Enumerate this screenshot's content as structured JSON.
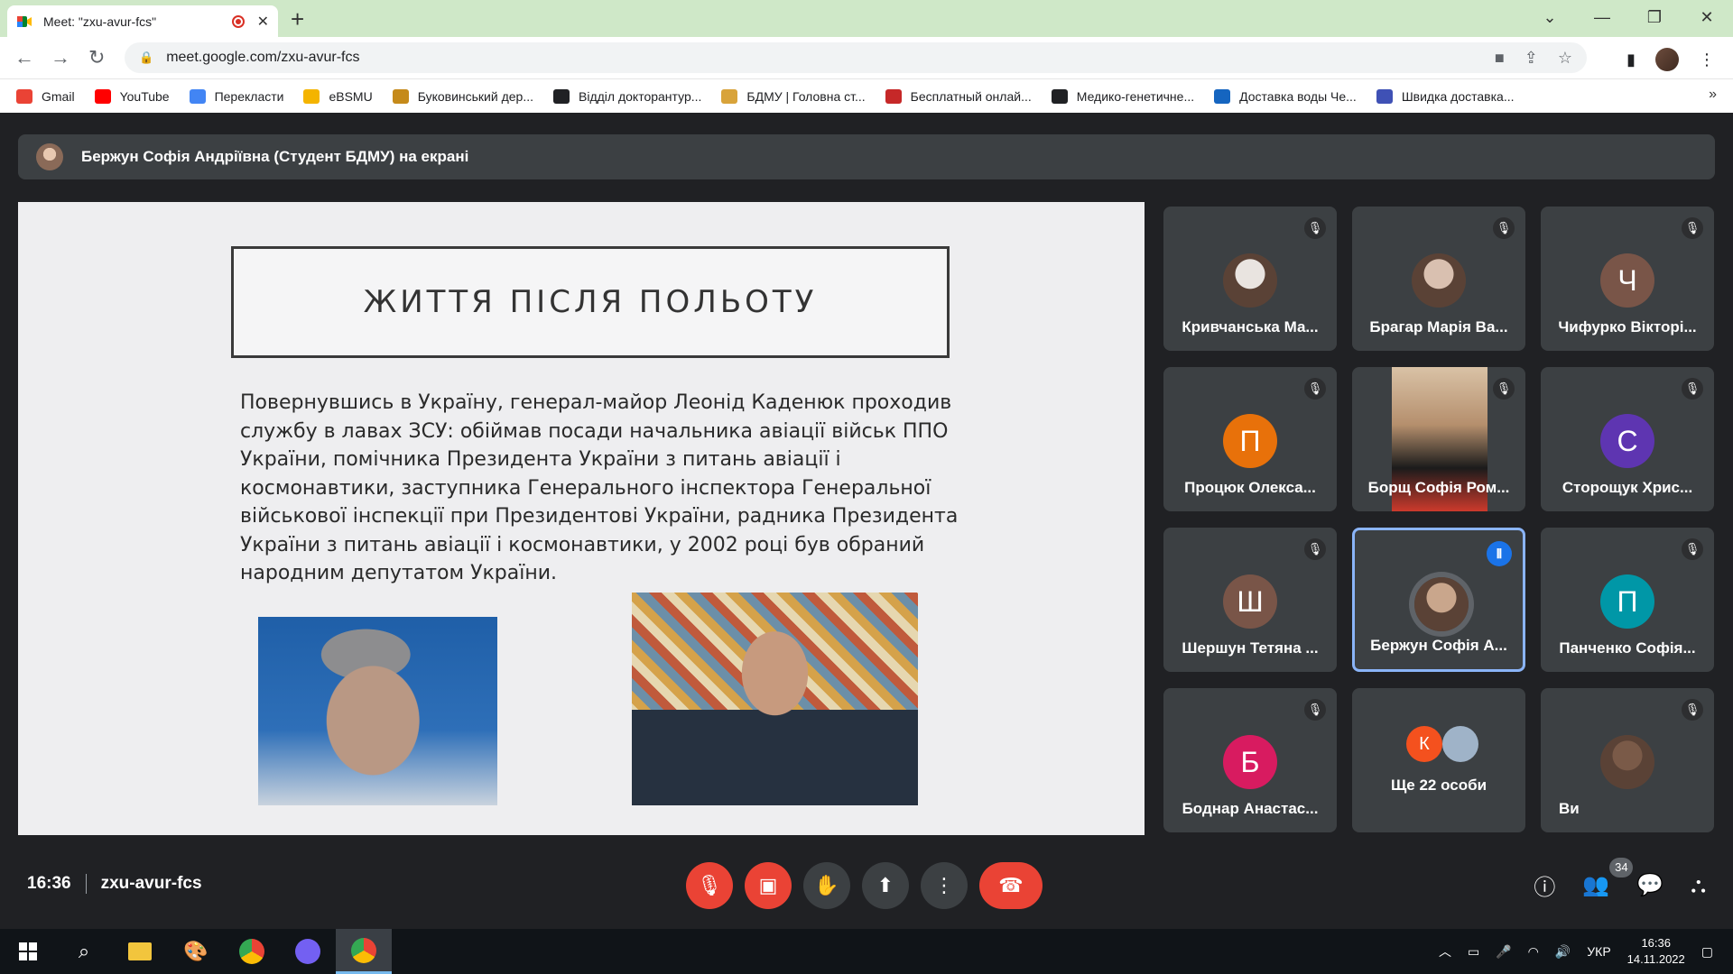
{
  "browser": {
    "tab_title": "Meet: \"zxu-avur-fcs\"",
    "url": "meet.google.com/zxu-avur-fcs",
    "bookmarks": [
      {
        "label": "Gmail",
        "color": "#ea4335"
      },
      {
        "label": "YouTube",
        "color": "#ff0000"
      },
      {
        "label": "Перекласти",
        "color": "#4285f4"
      },
      {
        "label": "eBSMU",
        "color": "#f4b400"
      },
      {
        "label": "Буковинський дер...",
        "color": "#c58a1a"
      },
      {
        "label": "Відділ докторантур...",
        "color": "#202124"
      },
      {
        "label": "БДМУ | Головна ст...",
        "color": "#d8a33a"
      },
      {
        "label": "Бесплатный онлай...",
        "color": "#c62828"
      },
      {
        "label": "Медико-генетичне...",
        "color": "#202124"
      },
      {
        "label": "Доставка воды Че...",
        "color": "#1565c0"
      },
      {
        "label": "Швидка доставка...",
        "color": "#3f51b5"
      }
    ]
  },
  "meet": {
    "presenter_text": "Бержун Софія Андріївна (Студент БДМУ) на екрані",
    "slide": {
      "title": "ЖИТТЯ ПІСЛЯ ПОЛЬОТУ",
      "body": "Повернувшись в Україну, генерал-майор Леонід Каденюк проходив службу в лавах ЗСУ: обіймав посади начальника авіації військ ППО України, помічника Президента України з питань авіації і космонавтики, заступника Генерального інспектора Генеральної військової інспекції при Президентові України, радника Президента України з питань авіації і космонавтики, у 2002 році був обраний народним депутатом України."
    },
    "participants": [
      {
        "name": "Кривчанська Ма...",
        "initial": "",
        "color": "#e9e4e0",
        "photo": true
      },
      {
        "name": "Брагар Марія Ва...",
        "initial": "",
        "color": "#d9c0b0",
        "photo": true
      },
      {
        "name": "Чифурко Вікторі...",
        "initial": "Ч",
        "color": "#795548"
      },
      {
        "name": "Процюк Олекса...",
        "initial": "П",
        "color": "#e8710a"
      },
      {
        "name": "Борщ Софія Ром...",
        "initial": "",
        "color": "",
        "video": true
      },
      {
        "name": "Сторощук Хрис...",
        "initial": "С",
        "color": "#5e35b1"
      },
      {
        "name": "Шершун Тетяна ...",
        "initial": "Ш",
        "color": "#795548"
      },
      {
        "name": "Бержун Софія А...",
        "initial": "",
        "color": "#c9a68c",
        "photo": true,
        "active": true
      },
      {
        "name": "Панченко Софія...",
        "initial": "П",
        "color": "#0097a7"
      },
      {
        "name": "Боднар Анастас...",
        "initial": "Б",
        "color": "#d81b60"
      },
      {
        "name": "Ще 22 особи",
        "initial": "К",
        "color": "#f4511e",
        "more": true
      },
      {
        "name": "Ви",
        "initial": "",
        "color": "#7a5a48",
        "photo": true,
        "left": true
      }
    ],
    "time": "16:36",
    "meeting_code": "zxu-avur-fcs",
    "people_count": "34"
  },
  "taskbar": {
    "language": "УКР",
    "clock_time": "16:36",
    "clock_date": "14.11.2022"
  }
}
